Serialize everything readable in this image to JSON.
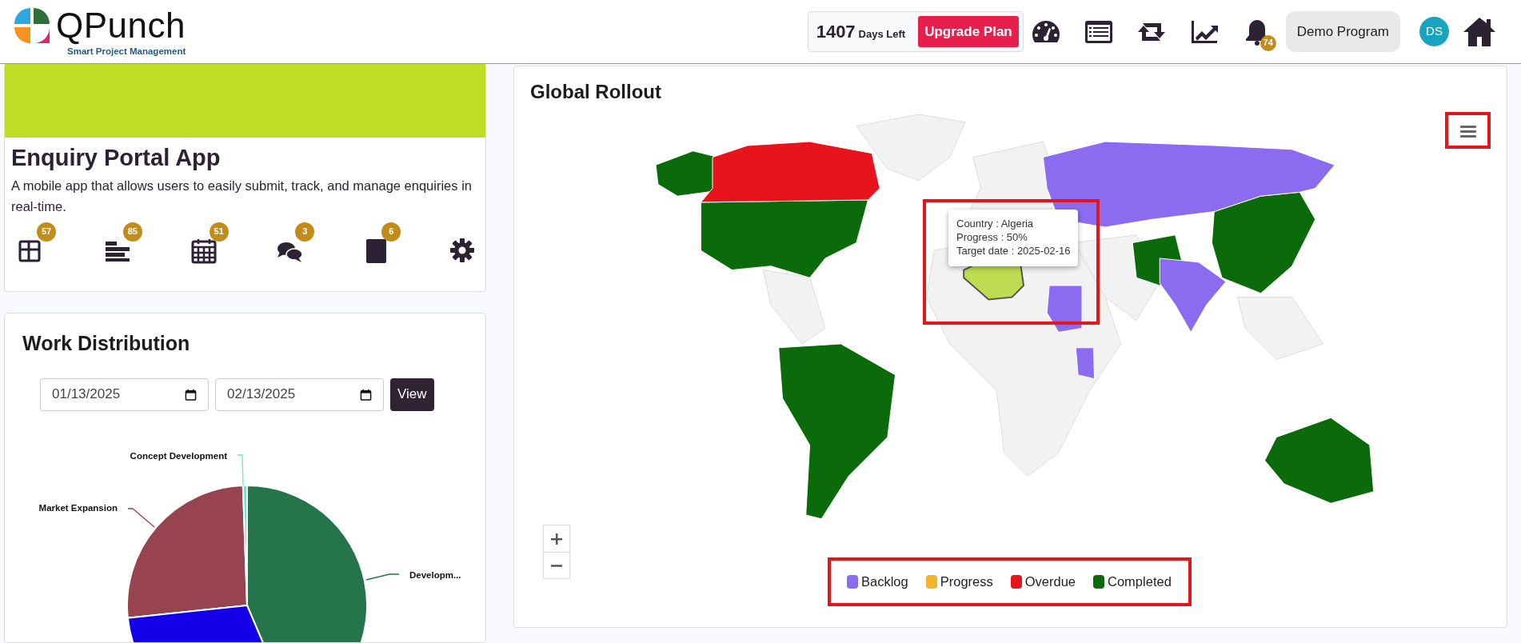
{
  "header": {
    "logo": {
      "name": "QPunch",
      "tagline": "Smart Project Management"
    },
    "days": {
      "count": "1407",
      "label": "Days Left"
    },
    "upgrade_button": "Upgrade Plan",
    "notifications": {
      "badge": "74"
    },
    "program_button": "Demo Program",
    "avatar": "DS"
  },
  "project_card": {
    "title": "Enquiry Portal App",
    "description": "A mobile app that allows users to easily submit, track, and manage enquiries in real-time.",
    "tools": [
      {
        "kind": "board",
        "badge": "57"
      },
      {
        "kind": "list",
        "badge": "85"
      },
      {
        "kind": "calendar",
        "badge": "51"
      },
      {
        "kind": "chat",
        "badge": "3"
      },
      {
        "kind": "document",
        "badge": "6"
      },
      {
        "kind": "settings"
      }
    ]
  },
  "work_distribution": {
    "title": "Work Distribution",
    "from_date": "01/13/2025",
    "to_date": "02/13/2025",
    "view_button": "View",
    "pie_slices": [
      {
        "label": "Concept Development",
        "color": "#4ef5c8"
      },
      {
        "label": "Developm...",
        "color": "#26744a"
      },
      {
        "color": "#1400e8"
      },
      {
        "label": "Market Expansion",
        "color": "#974450"
      }
    ]
  },
  "global_rollout": {
    "title": "Global Rollout",
    "tooltip": {
      "lines": [
        "Country : Algeria",
        "Progress : 50%",
        "Target date : 2025-02-16"
      ]
    },
    "legend": [
      {
        "label": "Backlog",
        "color": "#8b6cf0"
      },
      {
        "label": "Progress",
        "color": "#f5b22e"
      },
      {
        "label": "Overdue",
        "color": "#e8141b"
      },
      {
        "label": "Completed",
        "color": "#0b6b0b"
      }
    ]
  }
}
